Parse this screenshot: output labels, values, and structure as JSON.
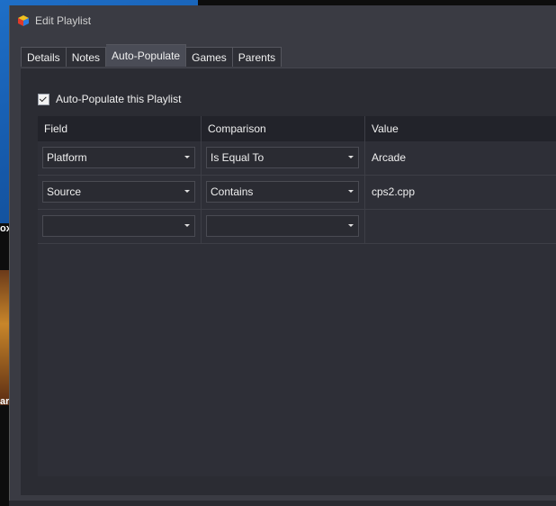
{
  "window": {
    "title": "Edit Playlist"
  },
  "tabs": [
    {
      "label": "Details",
      "active": false
    },
    {
      "label": "Notes",
      "active": false
    },
    {
      "label": "Auto-Populate",
      "active": true
    },
    {
      "label": "Games",
      "active": false
    },
    {
      "label": "Parents",
      "active": false
    }
  ],
  "auto_populate": {
    "checkbox_label": "Auto-Populate this Playlist",
    "checked": true
  },
  "grid": {
    "columns": [
      "Field",
      "Comparison",
      "Value"
    ],
    "rows": [
      {
        "field": "Platform",
        "comparison": "Is Equal To",
        "value": "Arcade"
      },
      {
        "field": "Source",
        "comparison": "Contains",
        "value": "cps2.cpp"
      },
      {
        "field": "",
        "comparison": "",
        "value": ""
      }
    ]
  },
  "background": {
    "fragment_1": "ox",
    "fragment_2": "ar"
  },
  "colors": {
    "window_bg": "#3a3b43",
    "panel_bg": "#2b2c33",
    "header_bg": "#22232a",
    "active_tab": "#4a4c56"
  },
  "icons": [
    "app-logo-icon",
    "checkmark-icon",
    "dropdown-arrow-icon"
  ]
}
